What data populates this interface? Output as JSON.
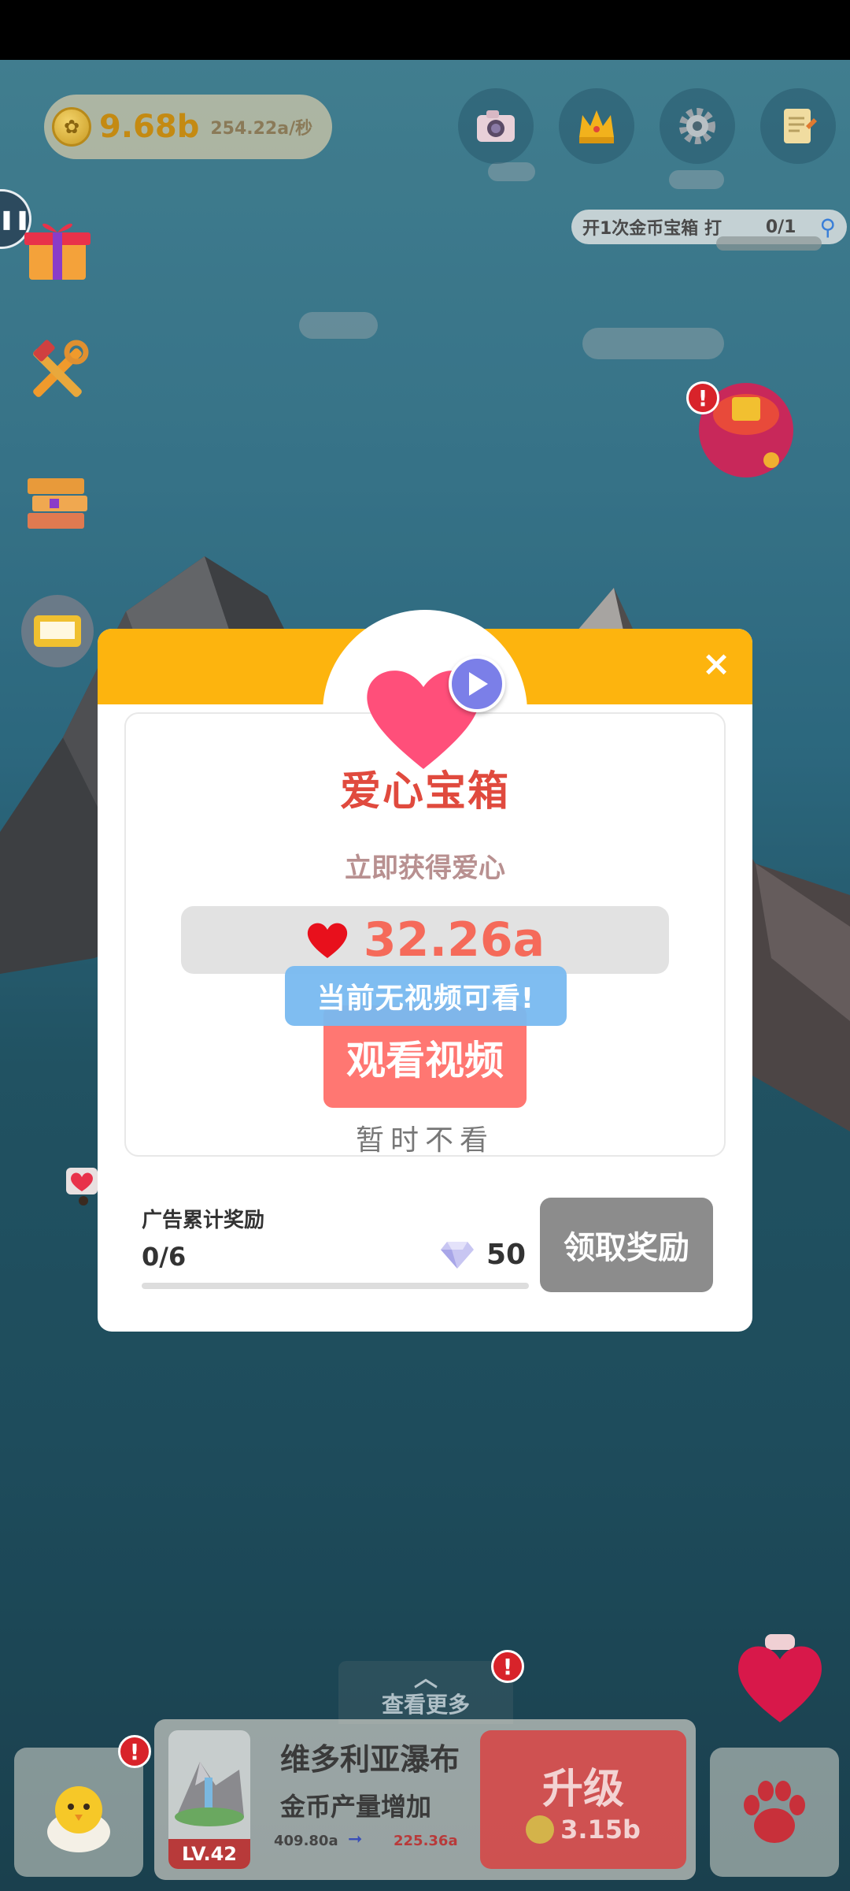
{
  "hud": {
    "coin_amount": "9.68b",
    "coin_rate": "254.22a/秒",
    "icons": [
      "camera-icon",
      "crown-icon",
      "gear-icon",
      "notepad-icon"
    ]
  },
  "task": {
    "text": "开1次金币宝箱",
    "suffix": "打",
    "count": "0/1"
  },
  "side_icons": [
    "gift-icon",
    "tools-icon",
    "books-icon",
    "slot-machine-icon",
    "treasure-chest-icon"
  ],
  "modal": {
    "title": "爱心宝箱",
    "subtitle": "立即获得爱心",
    "reward_value": "32.26a",
    "watch_label": "观看视频",
    "toast": "当前无视频可看!",
    "skip_label": "暂时不看",
    "close_label": "×",
    "accumulated": {
      "label": "广告累计奖励",
      "count": "0/6",
      "reward": "50",
      "progress": 0
    },
    "claim_label": "领取奖励"
  },
  "bottom": {
    "see_more": "查看更多",
    "building": {
      "name": "维多利亚瀑布",
      "level": "LV.42",
      "production_label": "金币产量增加",
      "from": "409.80a",
      "to": "225.36a"
    },
    "upgrade": {
      "label": "升级",
      "cost": "3.15b"
    }
  },
  "colors": {
    "header": "#fdb40e",
    "title": "#e04a3e",
    "reward": "#f56a5a",
    "watch_button": "#ff7772",
    "toast": "#78b9f0",
    "claim_button": "#8c8c8c"
  }
}
